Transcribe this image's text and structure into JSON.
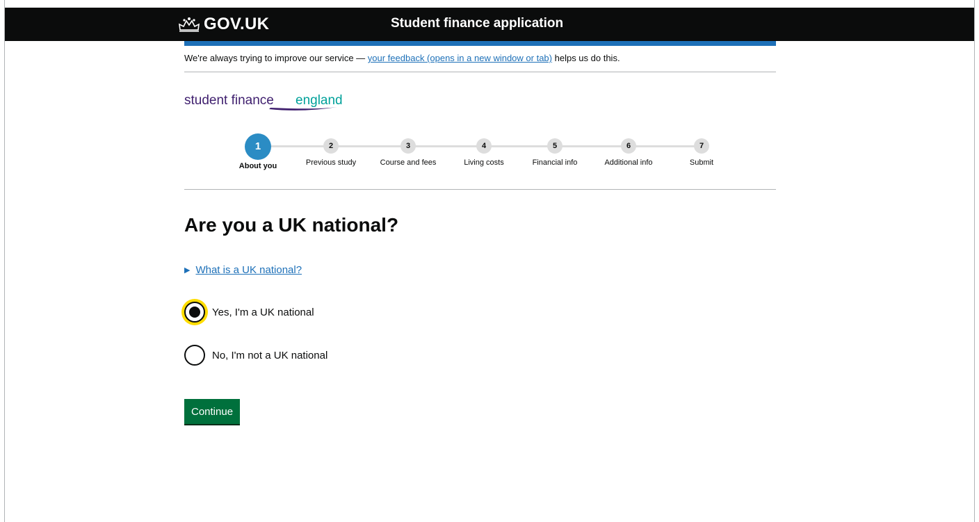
{
  "header": {
    "logo_text": "GOV.UK",
    "service_name": "Student finance application"
  },
  "feedback": {
    "prefix": "We're always trying to improve our service — ",
    "link_text": "your feedback (opens in a new window or tab)",
    "suffix": " helps us do this."
  },
  "brand": {
    "text_dark": "student finance",
    "text_accent": "england",
    "dark_color": "#3f1f6e",
    "accent_color": "#00a19a"
  },
  "stepper": {
    "active_color": "#2b8cc4",
    "steps": [
      {
        "number": "1",
        "label": "About you",
        "active": true
      },
      {
        "number": "2",
        "label": "Previous study",
        "active": false
      },
      {
        "number": "3",
        "label": "Course and fees",
        "active": false
      },
      {
        "number": "4",
        "label": "Living costs",
        "active": false
      },
      {
        "number": "5",
        "label": "Financial info",
        "active": false
      },
      {
        "number": "6",
        "label": "Additional info",
        "active": false
      },
      {
        "number": "7",
        "label": "Submit",
        "active": false
      }
    ]
  },
  "main": {
    "question": "Are you a UK national?",
    "details_link": "What is a UK national?",
    "options": [
      {
        "label": "Yes, I'm a UK national",
        "checked": true
      },
      {
        "label": "No, I'm not a UK national",
        "checked": false
      }
    ],
    "continue_label": "Continue"
  },
  "colors": {
    "link": "#1d70b8",
    "button": "#00703c",
    "focus": "#ffdd00"
  }
}
